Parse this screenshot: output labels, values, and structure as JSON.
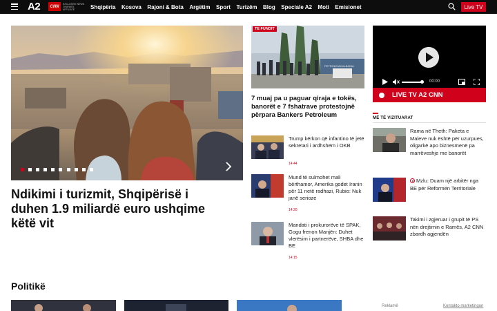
{
  "header": {
    "logo_text": "A2",
    "logo_cnn": "CNN",
    "logo_tagline": "Exclusive news channel affiliate",
    "nav": [
      "Shqipëria",
      "Kosova",
      "Rajoni & Bota",
      "Argëtim",
      "Sport",
      "Turizëm",
      "Blog",
      "Speciale A2",
      "Moti",
      "Emisionet"
    ],
    "live_button": "Live TV"
  },
  "hero": {
    "title": "Ndikimi i turizmit, Shqipërisë i duhen 1.9 miliardë euro ushqime këtë vit",
    "slide_count": 10,
    "active_slide": 1
  },
  "featured": {
    "badge": "TE FUNDIT",
    "title": "7 muaj pa u paguar qiraja e tokës, banorët e 7 fshatrave protestojnë përpara Bankers Petroleum",
    "image_caption": "PETROLEUM ALBANIA"
  },
  "news": [
    {
      "text": "Trump kërkon që infantino të jetë sekretari i ardhshëm i OKB",
      "time": "14:44"
    },
    {
      "text": "Mund të sulmohet mali bërthamor, Amerika godet Iranin për 11 netë radhazi, Rubio: Nuk janë serioze",
      "time": "14:20"
    },
    {
      "text": "Mandati i prokurorëve të SPAK, Gogu frenon Manjën: Duhet vlerësim i partnerëve, SHBA dhe BE",
      "time": "14:15"
    }
  ],
  "player": {
    "time": "00:00",
    "live_label": "LIVE TV A2 CNN"
  },
  "most_viewed": {
    "heading": "MË TË VIZITUARAT",
    "items": [
      {
        "text": "Rama në Theth: Paketa e Maleve nuk është për uzurpues, oligarkë apo biznesmenë pa marrëveshje me banorët"
      },
      {
        "text": "Mzlu: Duam një arbitër nga BE për Reformën Territoriale",
        "live": true
      },
      {
        "text": "Takimi i zgjeruar i grupit të PS nën drejtimin e Ramës, A2 CNN zbardh agjendën"
      }
    ]
  },
  "bottom": {
    "section_title": "Politikë",
    "ad_label": "Reklamë",
    "contact_link": "Kontakto marketingun"
  },
  "colors": {
    "accent": "#d0021b",
    "topbar": "#0d0d0d"
  }
}
